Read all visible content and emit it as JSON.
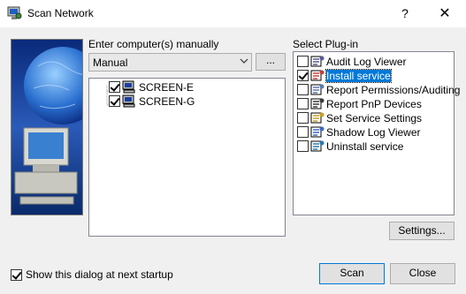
{
  "window": {
    "title": "Scan Network",
    "help": "?",
    "close": "✕"
  },
  "computers": {
    "label": "Enter computer(s) manually",
    "combo_value": "Manual",
    "browse_label": "...",
    "items": [
      {
        "name": "SCREEN-E",
        "checked": true
      },
      {
        "name": "SCREEN-G",
        "checked": true
      }
    ]
  },
  "plugins": {
    "label": "Select Plug-in",
    "items": [
      {
        "name": "Audit Log Viewer",
        "checked": false,
        "icon": "audit-log-icon"
      },
      {
        "name": "Install service",
        "checked": true,
        "icon": "install-service-icon",
        "selected": true
      },
      {
        "name": "Report Permissions/Auditing",
        "checked": false,
        "icon": "report-permissions-icon"
      },
      {
        "name": "Report PnP Devices",
        "checked": false,
        "icon": "pnp-devices-icon"
      },
      {
        "name": "Set Service Settings",
        "checked": false,
        "icon": "service-settings-icon"
      },
      {
        "name": "Shadow Log Viewer",
        "checked": false,
        "icon": "shadow-log-icon"
      },
      {
        "name": "Uninstall service",
        "checked": false,
        "icon": "uninstall-service-icon"
      }
    ],
    "settings_label": "Settings..."
  },
  "footer": {
    "startup_label": "Show this dialog at next startup",
    "startup_checked": true,
    "scan_label": "Scan",
    "close_label": "Close"
  }
}
